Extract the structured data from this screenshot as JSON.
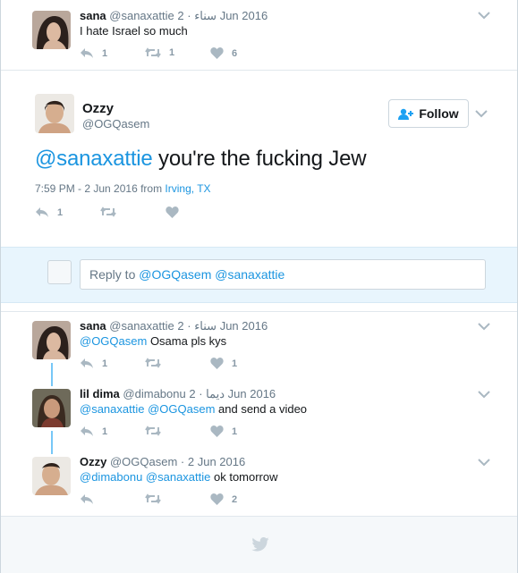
{
  "tweet_top": {
    "name": "sana",
    "handle": "@sanaxattie",
    "arabic_name": "سناء",
    "date": "2 Jun 2016",
    "text": "I hate Israel so much",
    "replies": "1",
    "retweets": "1",
    "likes": "6"
  },
  "main_tweet": {
    "name": "Ozzy",
    "handle": "@OGQasem",
    "follow_label": "Follow",
    "mention": "@sanaxattie",
    "text": " you're the fucking Jew",
    "timestamp": "7:59 PM - 2 Jun 2016 from",
    "location": "Irving, TX",
    "replies": "1"
  },
  "reply_composer": {
    "prefix": "Reply to",
    "mention1": "@OGQasem",
    "mention2": "@sanaxattie"
  },
  "replies": [
    {
      "name": "sana",
      "handle": "@sanaxattie",
      "arabic_name": "سناء",
      "date": "2 Jun 2016",
      "mentions": "@OGQasem",
      "text": " Osama pls kys",
      "replies": "1",
      "likes": "1"
    },
    {
      "name": "lil dima",
      "handle": "@dimabonu",
      "arabic_name": "ديما",
      "date": "2 Jun 2016",
      "mentions": "@sanaxattie @OGQasem",
      "text": " and send a video",
      "replies": "1",
      "likes": "1"
    },
    {
      "name": "Ozzy",
      "handle": "@OGQasem",
      "date": "2 Jun 2016",
      "mentions": "@dimabonu @sanaxattie",
      "text": " ok tomorrow",
      "likes": "2"
    }
  ],
  "colors": {
    "accent": "#1da1f2",
    "link": "#1b95e0",
    "muted": "#8899a6",
    "composer_bg": "#e8f5fd"
  }
}
